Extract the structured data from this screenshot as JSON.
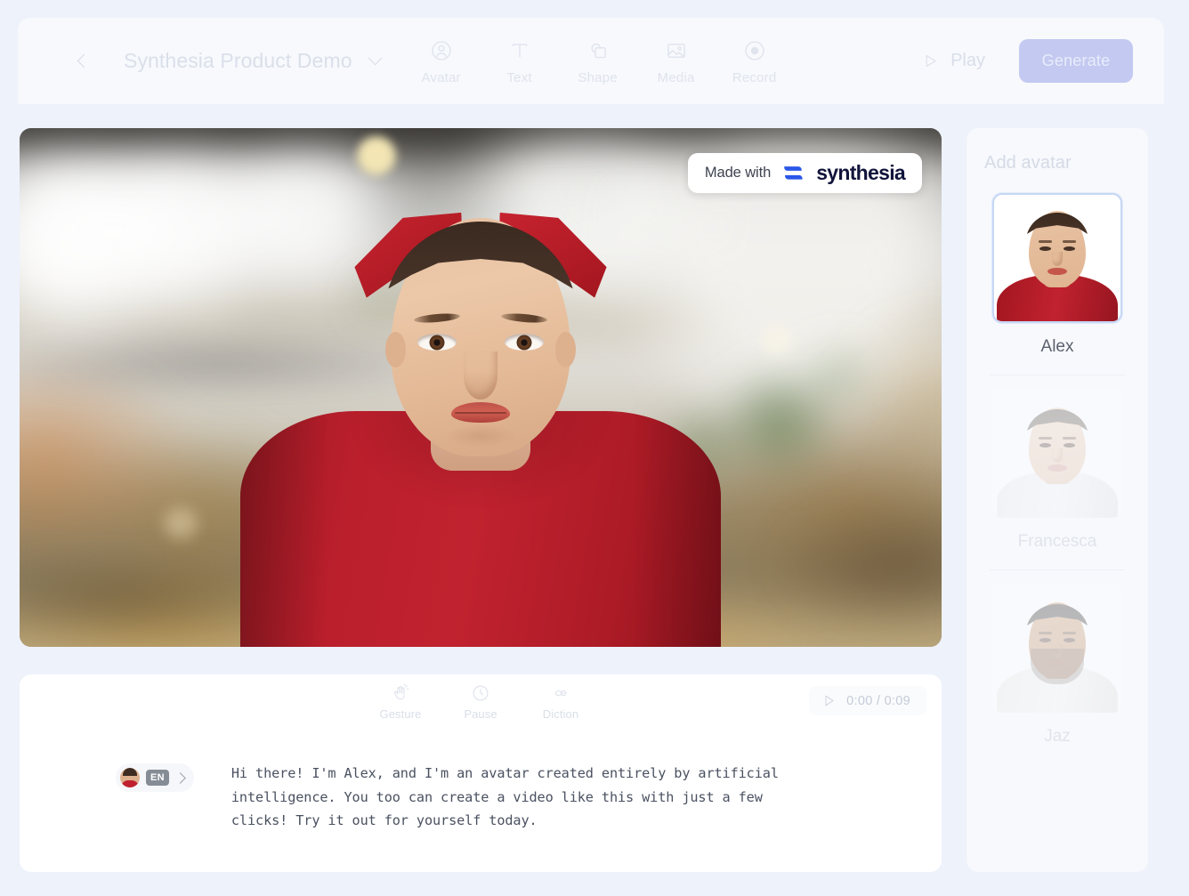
{
  "topbar": {
    "back_icon": "chevron-left-icon",
    "title": "Synthesia Product Demo",
    "title_caret_icon": "chevron-down-icon",
    "tools": [
      {
        "label": "Avatar",
        "icon": "avatar-person-circle-icon"
      },
      {
        "label": "Text",
        "icon": "text-t-icon"
      },
      {
        "label": "Shape",
        "icon": "shape-square-circle-icon"
      },
      {
        "label": "Media",
        "icon": "media-image-icon"
      },
      {
        "label": "Record",
        "icon": "record-dot-circle-icon"
      }
    ],
    "play_label": "Play",
    "play_icon": "play-triangle-icon",
    "generate_label": "Generate",
    "generate_color": "#c3c9f0"
  },
  "stage": {
    "watermark": {
      "made_with": "Made with",
      "brand": "synthesia",
      "logo_icon": "synthesia-logo-icon",
      "logo_color": "#2a57e8",
      "brand_color": "#11143a"
    },
    "avatar_shirt_color": "#c1222f"
  },
  "script_panel": {
    "tools": [
      {
        "label": "Gesture",
        "icon": "hand-wave-icon"
      },
      {
        "label": "Pause",
        "icon": "clock-icon"
      },
      {
        "label": "Diction",
        "icon": "ae-ligature-icon"
      }
    ],
    "timecode": "0:00 / 0:09",
    "timecode_icon": "play-triangle-icon",
    "lang_chip": {
      "avatar_icon": "avatar-thumbnail-icon",
      "lang": "EN",
      "arrow_icon": "chevron-right-icon"
    },
    "text": "Hi there! I'm Alex, and I'm an avatar created entirely by artificial intelligence. You too can create a video like this with just a few clicks! Try it out for yourself today."
  },
  "sidebar": {
    "title": "Add avatar",
    "avatars": [
      {
        "name": "Alex",
        "selected": true
      },
      {
        "name": "Francesca",
        "selected": false
      },
      {
        "name": "Jaz",
        "selected": false
      }
    ]
  }
}
